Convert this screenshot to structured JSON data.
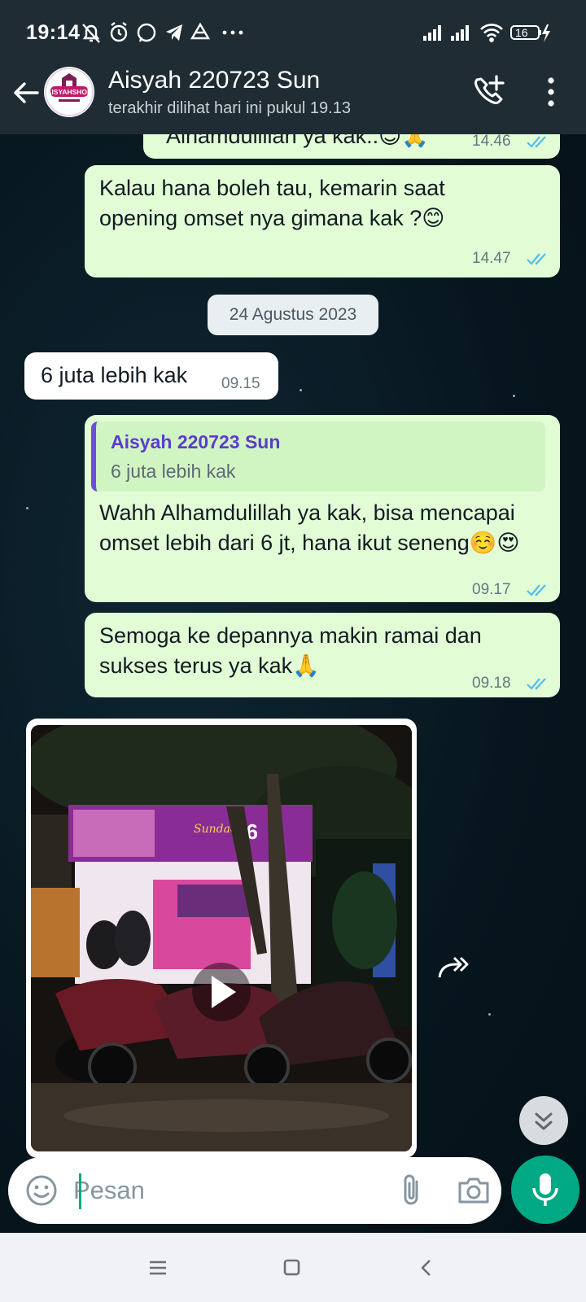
{
  "status_bar": {
    "time": "19:14",
    "battery": "16"
  },
  "header": {
    "contact_name": "Aisyah 220723 Sun",
    "last_seen": "terakhir dilihat hari ini pukul 19.13",
    "avatar_text": "AISYAHSHOP"
  },
  "messages": [
    {
      "direction": "out",
      "text": "Alhamdulillah ya kak..😊🙏",
      "time": "14.46"
    },
    {
      "direction": "out",
      "text": "Kalau hana boleh tau, kemarin saat opening omset nya gimana kak ?😊",
      "time": "14.47"
    },
    {
      "direction": "in",
      "text": "6 juta lebih kak",
      "time": "09.15"
    },
    {
      "direction": "out",
      "quote_author": "Aisyah 220723 Sun",
      "quote_text": "6 juta lebih kak",
      "text": "Wahh Alhamdulillah ya kak, bisa mencapai omset lebih dari 6 jt, hana ikut seneng☺️😍",
      "time": "09.17"
    },
    {
      "direction": "out",
      "text": "Semoga ke depannya makin ramai dan sukses terus ya kak🙏",
      "time": "09.18"
    }
  ],
  "date_chip": "24 Agustus 2023",
  "video": {
    "sign_text": "Sundae",
    "sign_number": "66"
  },
  "input": {
    "placeholder": "Pesan"
  },
  "colors": {
    "header_bg": "#1f2c34",
    "outgoing_bubble": "#e2fdd6",
    "incoming_bubble": "#ffffff",
    "accent_green": "#00a884",
    "read_ticks": "#53bdeb",
    "quote_bar": "#6a51d8"
  },
  "icons": [
    "back-arrow-icon",
    "add-call-icon",
    "more-vert-icon",
    "emoji-icon",
    "attach-icon",
    "camera-icon",
    "mic-icon",
    "forward-icon",
    "double-chevron-down-icon",
    "play-icon"
  ]
}
